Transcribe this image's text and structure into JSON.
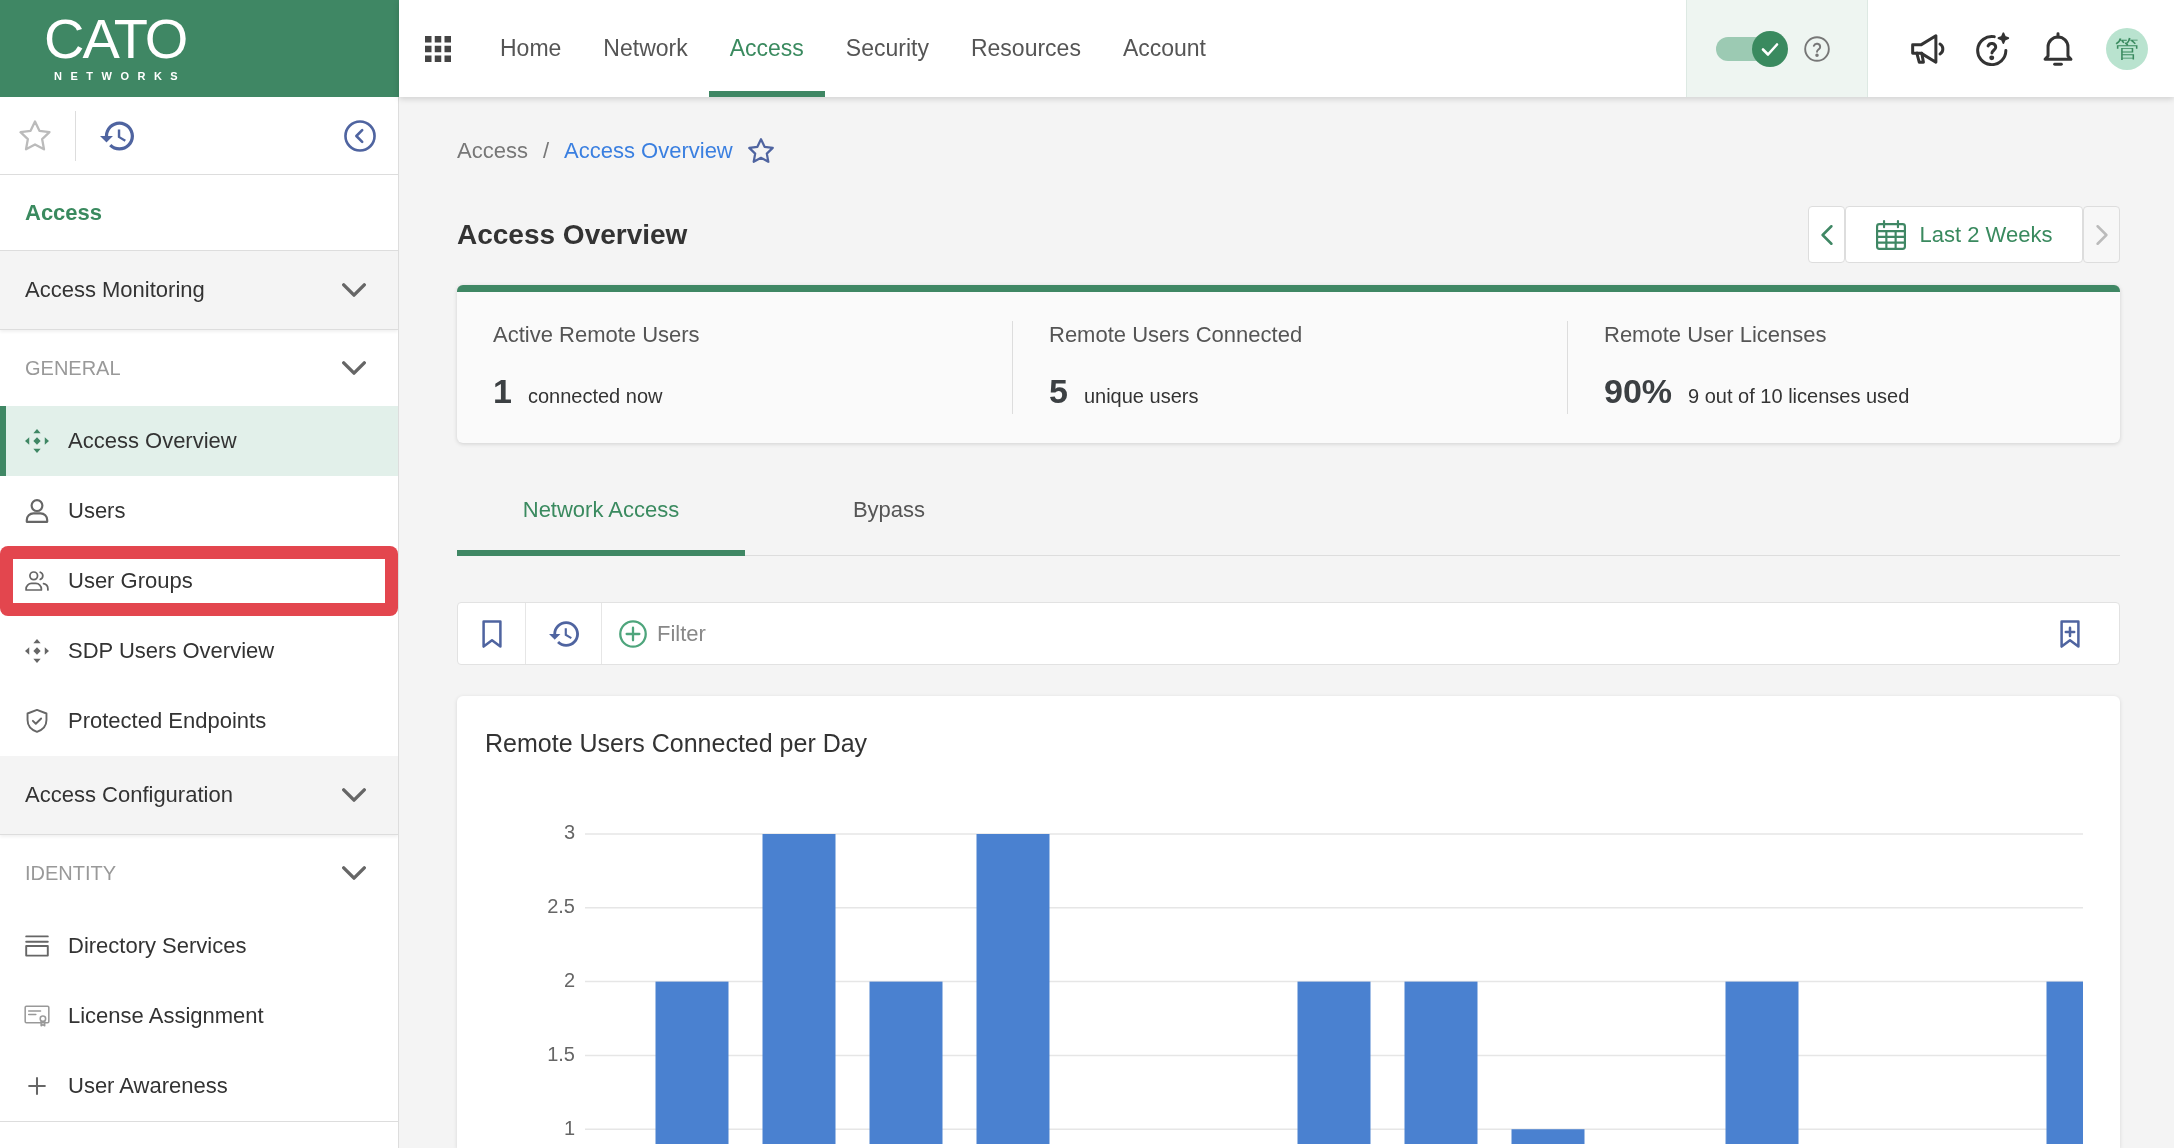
{
  "logo": {
    "wordmark": "CATO",
    "tagline": "NETWORKS"
  },
  "nav": {
    "items": [
      {
        "label": "Home",
        "selected": false
      },
      {
        "label": "Network",
        "selected": false
      },
      {
        "label": "Access",
        "selected": true
      },
      {
        "label": "Security",
        "selected": false
      },
      {
        "label": "Resources",
        "selected": false
      },
      {
        "label": "Account",
        "selected": false
      }
    ]
  },
  "toggle": {
    "on": true
  },
  "avatar": {
    "initial": "管"
  },
  "sidebar": {
    "title": "Access",
    "groups": [
      {
        "label": "Access Monitoring",
        "sections": [
          {
            "label": "GENERAL",
            "items": [
              {
                "label": "Access Overview",
                "selected": true,
                "highlighted": false
              },
              {
                "label": "Users",
                "selected": false,
                "highlighted": false
              },
              {
                "label": "User Groups",
                "selected": false,
                "highlighted": true
              },
              {
                "label": "SDP Users Overview",
                "selected": false,
                "highlighted": false
              },
              {
                "label": "Protected Endpoints",
                "selected": false,
                "highlighted": false
              }
            ]
          }
        ]
      },
      {
        "label": "Access Configuration",
        "sections": [
          {
            "label": "IDENTITY",
            "items": [
              {
                "label": "Directory Services",
                "selected": false,
                "highlighted": false
              },
              {
                "label": "License Assignment",
                "selected": false,
                "highlighted": false
              },
              {
                "label": "User Awareness",
                "selected": false,
                "highlighted": false
              }
            ]
          }
        ]
      }
    ]
  },
  "breadcrumb": {
    "items": [
      "Access",
      "Access Overview"
    ],
    "separator": "/"
  },
  "page_title": "Access Overview",
  "date_range": {
    "label": "Last 2 Weeks",
    "previous": {
      "disabled": false
    },
    "next": {
      "disabled": true
    }
  },
  "stats": [
    {
      "label": "Active Remote Users",
      "value": "1",
      "detail": "connected now"
    },
    {
      "label": "Remote Users Connected",
      "value": "5",
      "detail": "unique users"
    },
    {
      "label": "Remote User Licenses",
      "value": "90%",
      "detail": "9 out of 10 licenses used"
    }
  ],
  "tabs": [
    {
      "label": "Network Access",
      "selected": true
    },
    {
      "label": "Bypass",
      "selected": false
    }
  ],
  "filter_bar": {
    "placeholder": "Filter"
  },
  "chart": {
    "chart_data": {
      "type": "bar",
      "title": "Remote Users Connected per Day",
      "values": [
        2,
        3,
        2,
        3,
        null,
        null,
        2,
        2,
        1,
        null,
        2,
        null,
        null,
        2
      ],
      "ylim": [
        0.9,
        3
      ],
      "yticks": [
        1,
        1.5,
        2,
        2.5,
        3
      ],
      "grid": true
    }
  }
}
